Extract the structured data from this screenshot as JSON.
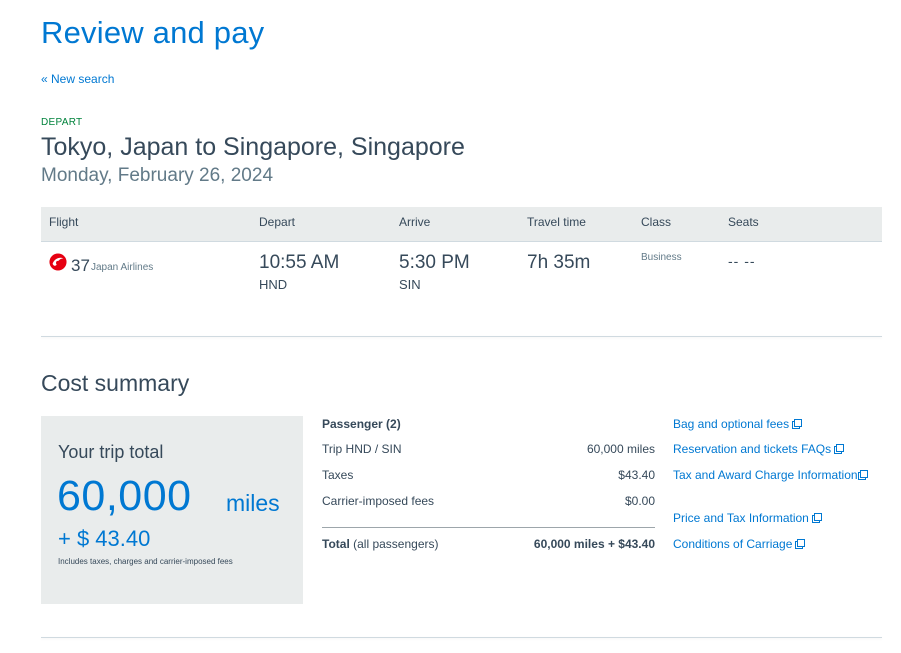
{
  "page": {
    "title": "Review and pay",
    "new_search": "« New search"
  },
  "trip": {
    "direction_label": "DEPART",
    "route": "Tokyo, Japan to Singapore, Singapore",
    "date": "Monday, February 26, 2024"
  },
  "flight_table": {
    "headers": [
      "Flight",
      "Depart",
      "Arrive",
      "Travel time",
      "Class",
      "Seats"
    ],
    "rows": [
      {
        "airline_icon": "jal-crane-icon",
        "flight_number": "37",
        "airline": "Japan Airlines",
        "depart_time": "10:55 AM",
        "depart_airport": "HND",
        "arrive_time": "5:30 PM",
        "arrive_airport": "SIN",
        "travel_time": "7h 35m",
        "class": "Business",
        "seats": "-- --"
      }
    ]
  },
  "cost_summary": {
    "title": "Cost summary",
    "trip_total_label": "Your trip total",
    "miles": "60,000",
    "miles_unit": "miles",
    "cash": "+ $ 43.40",
    "note": "Includes taxes, charges and carrier-imposed fees",
    "breakdown": {
      "heading": "Passenger (2)",
      "rows": [
        {
          "label": "Trip HND / SIN",
          "value": "60,000 miles"
        },
        {
          "label": "Taxes",
          "value": "$43.40"
        },
        {
          "label": "Carrier-imposed fees",
          "value": "$0.00"
        }
      ],
      "total_label_bold": "Total",
      "total_label_rest": "(all passengers)",
      "total_value": "60,000 miles + $43.40"
    },
    "links": [
      "Bag and optional fees",
      "Reservation and tickets FAQs",
      "Tax and Award Charge Information",
      "Price and Tax Information",
      "Conditions of Carriage"
    ]
  },
  "colors": {
    "brand_blue": "#0078d2",
    "depart_green": "#00823b",
    "jal_red": "#e60012"
  }
}
